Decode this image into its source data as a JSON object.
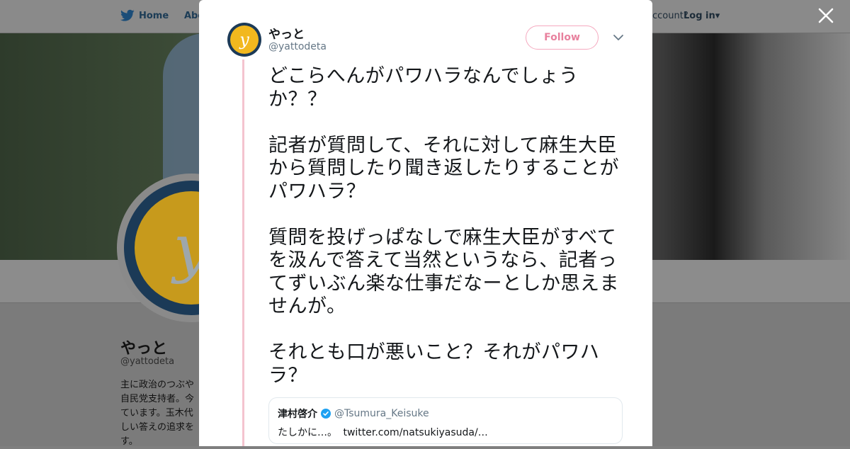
{
  "nav": {
    "home_label": "Home",
    "about_label": "Abo",
    "account_text": "ccount?",
    "login_label": "Log in"
  },
  "background_profile": {
    "name": "やっと",
    "handle": "@yattodeta",
    "bio": "主に政治のつぶや 自民党支持者。今 ています。玉木代 しい答えの追求を す。"
  },
  "close_icon": "close-icon",
  "tweet": {
    "author_name": "やっと",
    "author_handle": "@yattodeta",
    "follow_label": "Follow",
    "paragraphs": [
      "どこらへんがパワハラなんでしょうか？？",
      "記者が質問して、それに対して麻生大臣から質問したり聞き返したりすることがパワハラ？",
      "質問を投げっぱなしで麻生大臣がすべてを汲んで答えて当然というなら、記者ってずいぶん楽な仕事だなーとしか思えませんが。",
      "それとも口が悪いこと？それがパワハラ？"
    ],
    "quote": {
      "name": "津村啓介",
      "handle": "@Tsumura_Keisuke",
      "text": "たしかに…。",
      "link": "twitter.com/natsukiyasuda/…",
      "verified": true
    }
  },
  "colors": {
    "follow_accent": "#e8819e",
    "thread_line": "#f4c4cf",
    "verified_blue": "#1da1f2",
    "avatar_yellow": "#f2b81e",
    "avatar_navy": "#1c3a57"
  }
}
